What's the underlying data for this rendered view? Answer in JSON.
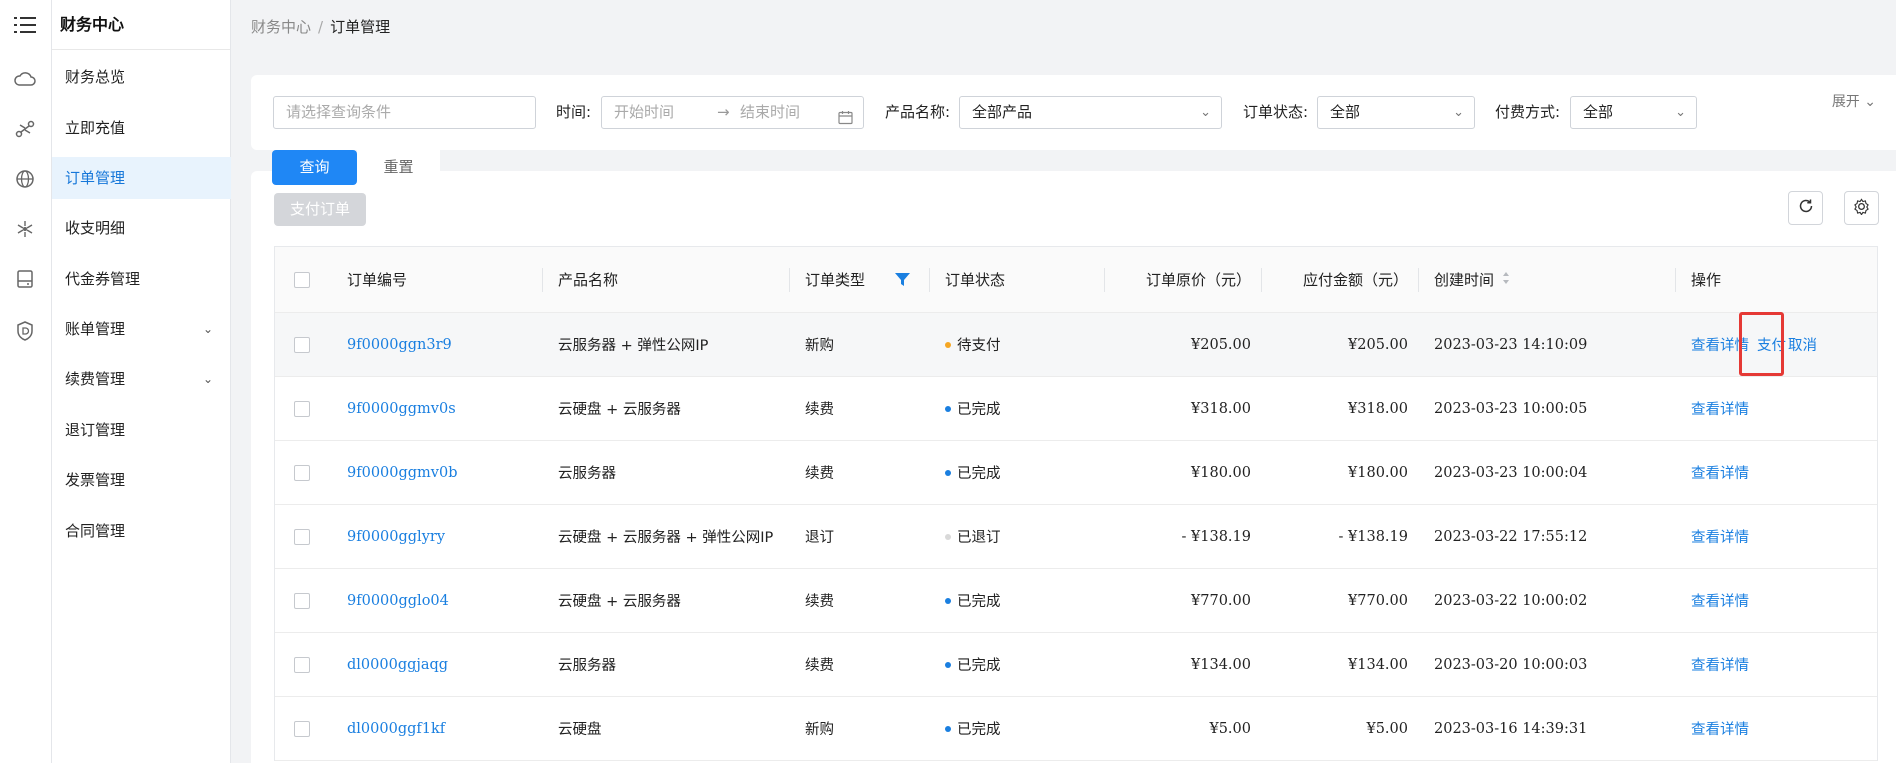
{
  "menu": {
    "title": "财务中心",
    "items": [
      {
        "label": "财务总览"
      },
      {
        "label": "立即充值"
      },
      {
        "label": "订单管理"
      },
      {
        "label": "收支明细"
      },
      {
        "label": "代金券管理"
      },
      {
        "label": "账单管理"
      },
      {
        "label": "续费管理"
      },
      {
        "label": "退订管理"
      },
      {
        "label": "发票管理"
      },
      {
        "label": "合同管理"
      }
    ]
  },
  "breadcrumb": {
    "root": "财务中心",
    "separator": "/",
    "current": "订单管理"
  },
  "filter": {
    "query_placeholder": "请选择查询条件",
    "time_label": "时间:",
    "start_placeholder": "开始时间",
    "arrow": "→",
    "end_placeholder": "结束时间",
    "product_label": "产品名称:",
    "product_value": "全部产品",
    "status_label": "订单状态:",
    "status_value": "全部",
    "pay_label": "付费方式:",
    "pay_value": "全部",
    "expand": "展开"
  },
  "actions": {
    "query": "查询",
    "reset": "重置",
    "pay_orders": "支付订单"
  },
  "table": {
    "headers": {
      "order_no": "订单编号",
      "product": "产品名称",
      "type": "订单类型",
      "status": "订单状态",
      "original": "订单原价（元）",
      "payable": "应付金额（元）",
      "created": "创建时间",
      "ops": "操作"
    },
    "rows": [
      {
        "order_no": "9f0000ggn3r9",
        "product": "云服务器 + 弹性公网IP",
        "type": "新购",
        "status": "待支付",
        "status_color": "#f5a623",
        "original": "¥205.00",
        "payable": "¥205.00",
        "created": "2023-03-23 14:10:09",
        "ops": [
          "查看详情",
          "支付",
          "取消"
        ]
      },
      {
        "order_no": "9f0000ggmv0s",
        "product": "云硬盘 + 云服务器",
        "type": "续费",
        "status": "已完成",
        "status_color": "#1a7fe0",
        "original": "¥318.00",
        "payable": "¥318.00",
        "created": "2023-03-23 10:00:05",
        "ops": [
          "查看详情"
        ]
      },
      {
        "order_no": "9f0000ggmv0b",
        "product": "云服务器",
        "type": "续费",
        "status": "已完成",
        "status_color": "#1a7fe0",
        "original": "¥180.00",
        "payable": "¥180.00",
        "created": "2023-03-23 10:00:04",
        "ops": [
          "查看详情"
        ]
      },
      {
        "order_no": "9f0000gglyry",
        "product": "云硬盘 + 云服务器 + 弹性公网IP",
        "type": "退订",
        "status": "已退订",
        "status_color": "#d9d9d9",
        "original": "- ¥138.19",
        "payable": "- ¥138.19",
        "created": "2023-03-22 17:55:12",
        "ops": [
          "查看详情"
        ]
      },
      {
        "order_no": "9f0000gglo04",
        "product": "云硬盘 + 云服务器",
        "type": "续费",
        "status": "已完成",
        "status_color": "#1a7fe0",
        "original": "¥770.00",
        "payable": "¥770.00",
        "created": "2023-03-22 10:00:02",
        "ops": [
          "查看详情"
        ]
      },
      {
        "order_no": "dl0000ggjaqg",
        "product": "云服务器",
        "type": "续费",
        "status": "已完成",
        "status_color": "#1a7fe0",
        "original": "¥134.00",
        "payable": "¥134.00",
        "created": "2023-03-20 10:00:03",
        "ops": [
          "查看详情"
        ]
      },
      {
        "order_no": "dl0000ggf1kf",
        "product": "云硬盘",
        "type": "新购",
        "status": "已完成",
        "status_color": "#1a7fe0",
        "original": "¥5.00",
        "payable": "¥5.00",
        "created": "2023-03-16 14:39:31",
        "ops": [
          "查看详情"
        ]
      }
    ]
  },
  "colors": {
    "accent": "#1f87f5",
    "link": "#1a7fe0",
    "highlight_box": "#e53935"
  }
}
